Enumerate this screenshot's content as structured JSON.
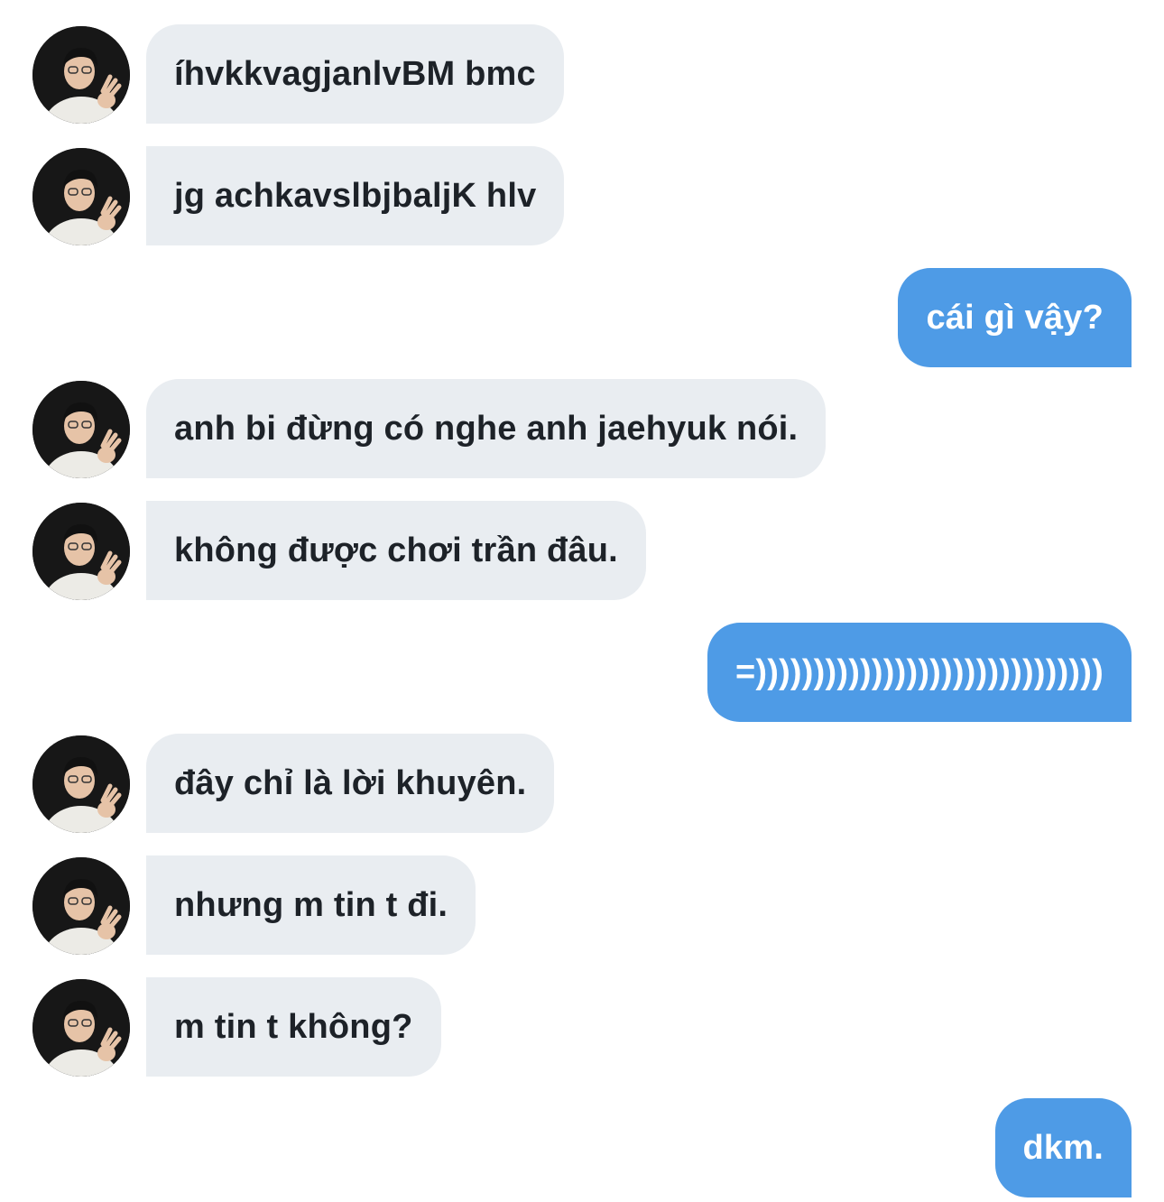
{
  "conversation": {
    "messages": [
      {
        "side": "in",
        "text": "íhvkkvagjanlvBM bmc",
        "avatar": "avatar-photo"
      },
      {
        "side": "in",
        "text": "jg achkavslbjbaljK hlv",
        "avatar": "avatar-photo"
      },
      {
        "side": "out",
        "text": "cái gì vậy?"
      },
      {
        "side": "in",
        "text": "anh bi đừng có nghe anh jaehyuk nói.",
        "avatar": "avatar-photo"
      },
      {
        "side": "in",
        "text": "không được chơi trần đâu.",
        "avatar": "avatar-photo"
      },
      {
        "side": "out",
        "text": "=))))))))))))))))))))))))))))))"
      },
      {
        "side": "in",
        "text": "đây chỉ là lời khuyên.",
        "avatar": "avatar-photo"
      },
      {
        "side": "in",
        "text": "nhưng m tin t đi.",
        "avatar": "avatar-photo"
      },
      {
        "side": "in",
        "text": "m tin t không?",
        "avatar": "avatar-photo"
      },
      {
        "side": "out",
        "text": "dkm."
      }
    ]
  },
  "colors": {
    "incoming_bubble": "#e9edf1",
    "incoming_text": "#1d2228",
    "outgoing_bubble": "#4e9be6",
    "outgoing_text": "#ffffff",
    "background": "#ffffff"
  }
}
